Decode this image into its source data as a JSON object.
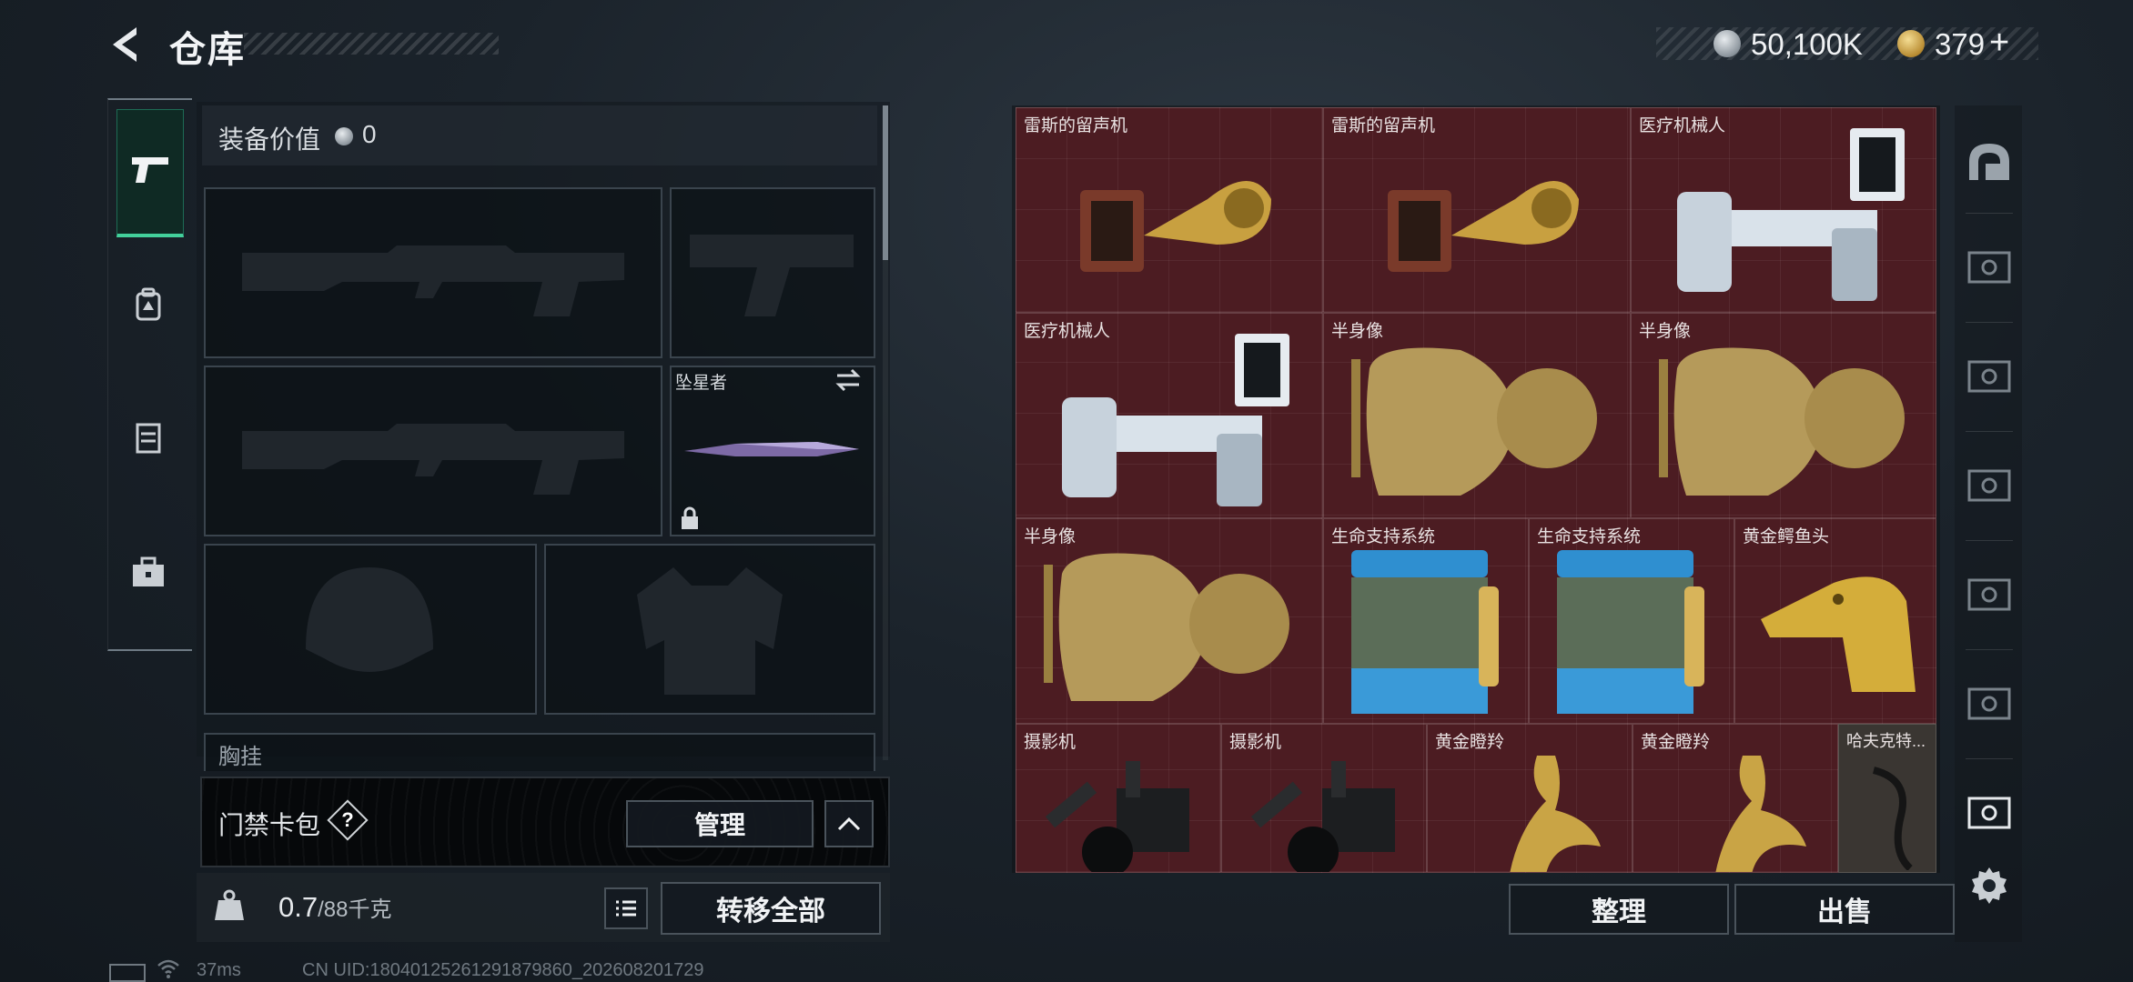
{
  "header": {
    "title": "仓库"
  },
  "currency": {
    "silver": "50,100K",
    "gold": "379",
    "add_label": "+"
  },
  "tabs": [
    {
      "name": "weapons",
      "active": true
    },
    {
      "name": "backpack"
    },
    {
      "name": "vest"
    },
    {
      "name": "supplies"
    }
  ],
  "loadout": {
    "equip_value_label": "装备价值",
    "equip_value": "0",
    "melee_label": "坠星者",
    "partial_label": "胸挂"
  },
  "keycard": {
    "label": "门禁卡包",
    "help": "?",
    "manage_label": "管理"
  },
  "weight": {
    "current": "0.7",
    "max": "/88",
    "unit": "千克"
  },
  "transfer_all_label": "转移全部",
  "storage": {
    "items": [
      {
        "label": "雷斯的留声机"
      },
      {
        "label": "雷斯的留声机"
      },
      {
        "label": "医疗机械人"
      },
      {
        "label": "医疗机械人"
      },
      {
        "label": "半身像"
      },
      {
        "label": "半身像"
      },
      {
        "label": "半身像"
      },
      {
        "label": "生命支持系统"
      },
      {
        "label": "生命支持系统"
      },
      {
        "label": "黄金鳄鱼头"
      },
      {
        "label": "摄影机"
      },
      {
        "label": "摄影机"
      },
      {
        "label": "黄金瞪羚"
      },
      {
        "label": "黄金瞪羚"
      },
      {
        "label": "哈夫克特..."
      }
    ],
    "sort_label": "整理",
    "sell_label": "出售"
  },
  "status": {
    "ping": "37ms",
    "uid": "CN UID:18040125261291879860_202608201729"
  },
  "colors": {
    "accent": "#43d09b",
    "grid_bg": "#4c1c22"
  }
}
